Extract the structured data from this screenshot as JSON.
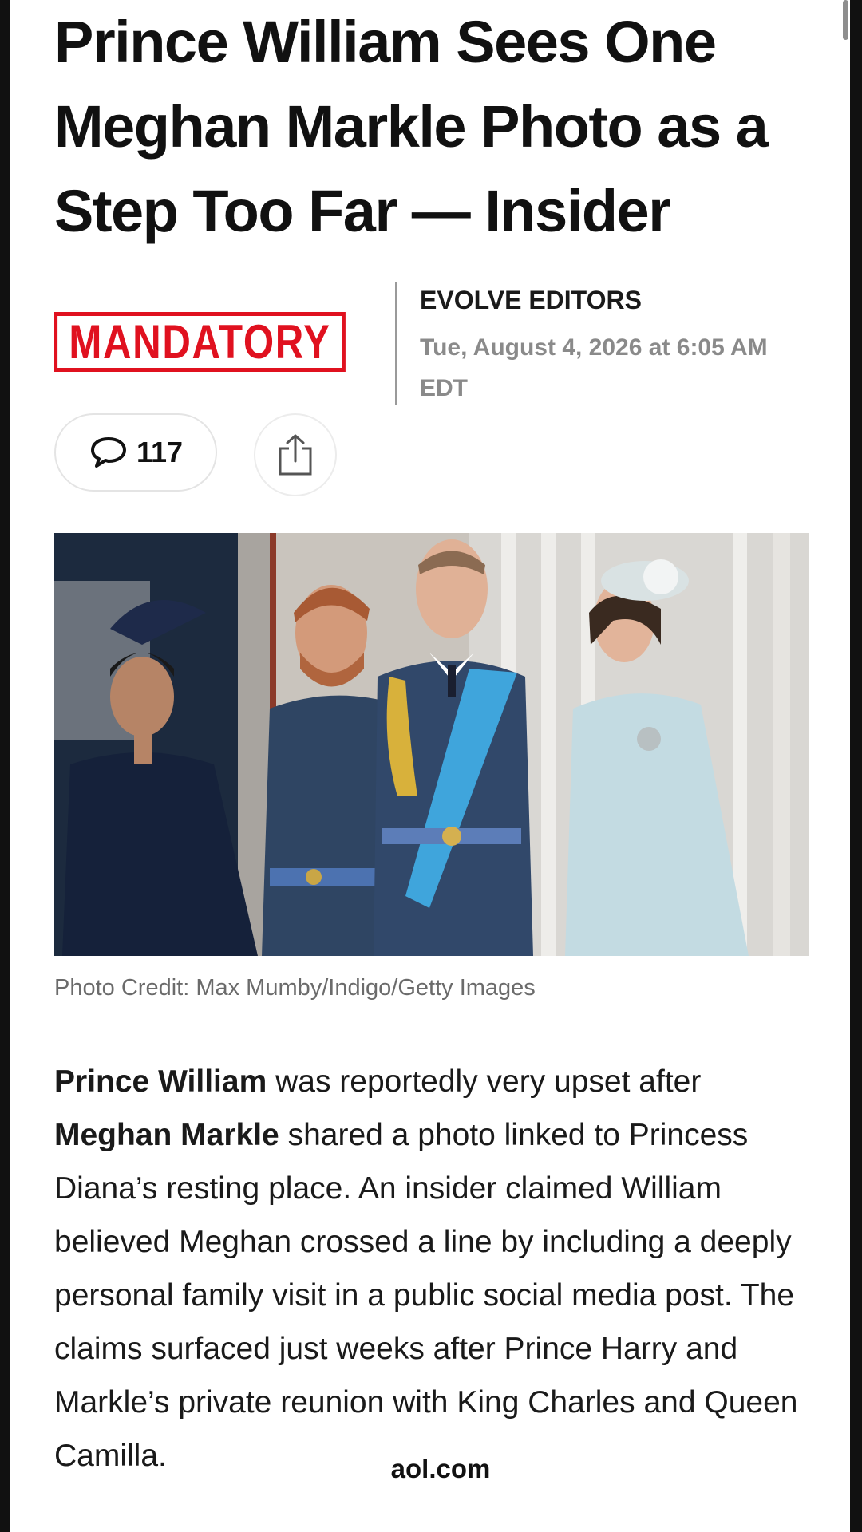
{
  "article": {
    "headline": "Prince William Sees One Meghan Markle Photo as a Step Too Far — Insider",
    "publisher_logo_text": "MANDATORY",
    "author": "EVOLVE EDITORS",
    "date": "Tue, August 4, 2026 at 6:05 AM EDT",
    "comments_count": "117",
    "photo_credit": "Photo Credit: Max Mumby/Indigo/Getty Images",
    "body": {
      "name1": "Prince William",
      "text1": " was reportedly very upset after ",
      "name2": "Meghan Markle",
      "text2": " shared a photo linked to Princess Diana’s resting place. An insider claimed William believed Meghan crossed a line by including a deeply personal family visit in a public social media post. The claims surfaced just weeks after Prince Harry and Markle’s private reunion with King Charles and Queen Camilla."
    }
  },
  "browser": {
    "source_domain": "aol.com"
  },
  "icons": {
    "comment": "speech-bubble-icon",
    "share": "share-icon"
  },
  "colors": {
    "logo_red": "#e0111f",
    "byline_gray": "#8a8a8a"
  }
}
